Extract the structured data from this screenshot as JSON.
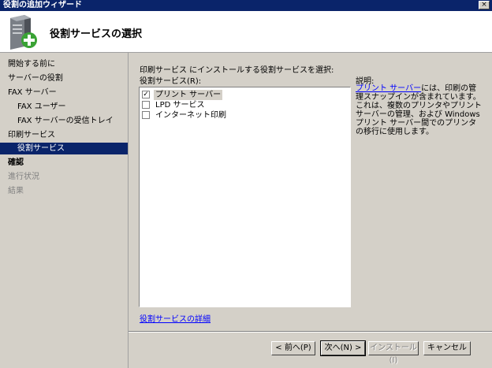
{
  "window": {
    "title": "役割の追加ウィザード",
    "close_glyph": "×"
  },
  "header": {
    "title": "役割サービスの選択",
    "icon": "server-add-icon"
  },
  "sidebar": {
    "items": [
      {
        "label": "開始する前に",
        "state": "normal"
      },
      {
        "label": "サーバーの役割",
        "state": "normal"
      },
      {
        "label": "FAX サーバー",
        "state": "normal"
      },
      {
        "label": "FAX ユーザー",
        "state": "sub"
      },
      {
        "label": "FAX サーバーの受信トレイ",
        "state": "sub"
      },
      {
        "label": "印刷サービス",
        "state": "normal"
      },
      {
        "label": "役割サービス",
        "state": "selected"
      },
      {
        "label": "確認",
        "state": "bold"
      },
      {
        "label": "進行状況",
        "state": "disabled"
      },
      {
        "label": "結果",
        "state": "disabled"
      }
    ]
  },
  "main": {
    "instruction": "印刷サービス にインストールする役割サービスを選択:",
    "listbox_label": "役割サービス(R):",
    "role_services": [
      {
        "label": "プリント サーバー",
        "checked": true,
        "check_glyph": "✓"
      },
      {
        "label": "LPD サービス",
        "checked": false,
        "check_glyph": ""
      },
      {
        "label": "インターネット印刷",
        "checked": false,
        "check_glyph": ""
      }
    ],
    "description": {
      "heading": "説明:",
      "link": "プリント サーバー",
      "text": "には、印刷の管理スナップインが含まれています。これは、複数のプリンタやプリント サーバーの管理、および Windows プリント サーバー間でのプリンタの移行に使用します。"
    },
    "detail_link": "役割サービスの詳細"
  },
  "buttons": {
    "prev": "< 前へ(P)",
    "next": "次へ(N) >",
    "install": "インストール(I)",
    "cancel": "キャンセル"
  },
  "colors": {
    "titlebar": "#0a246a",
    "selection": "#0a246a",
    "face": "#d4d0c8",
    "link": "#0000ff"
  }
}
